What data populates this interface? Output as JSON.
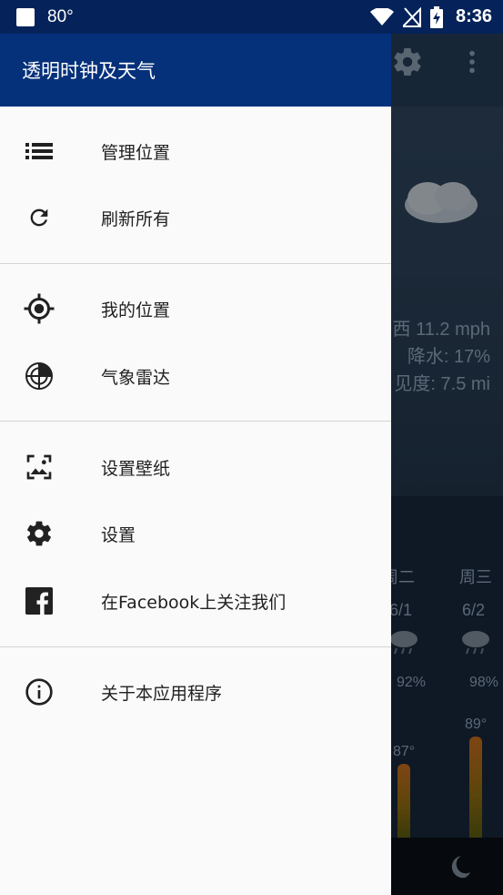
{
  "status_bar": {
    "temperature": "80°",
    "time": "8:36"
  },
  "app": {
    "title": "透明时钟及天气"
  },
  "menu": {
    "manage_locations": "管理位置",
    "refresh_all": "刷新所有",
    "my_location": "我的位置",
    "weather_radar": "气象雷达",
    "set_wallpaper": "设置壁纸",
    "settings": "设置",
    "follow_facebook": "在Facebook上关注我们",
    "about": "关于本应用程序"
  },
  "background": {
    "wind": "西 11.2 mph",
    "precip": "降水: 17%",
    "visibility": "见度: 7.5 mi",
    "forecast": [
      {
        "day": "周二",
        "date": "6/1",
        "humidity": "92%",
        "temp": "87°"
      },
      {
        "day": "周三",
        "date": "6/2",
        "humidity": "98%",
        "temp": "89°"
      }
    ]
  },
  "colors": {
    "header": "#05317a",
    "status_bar": "#05235a",
    "drawer_bg": "#fafafa"
  }
}
